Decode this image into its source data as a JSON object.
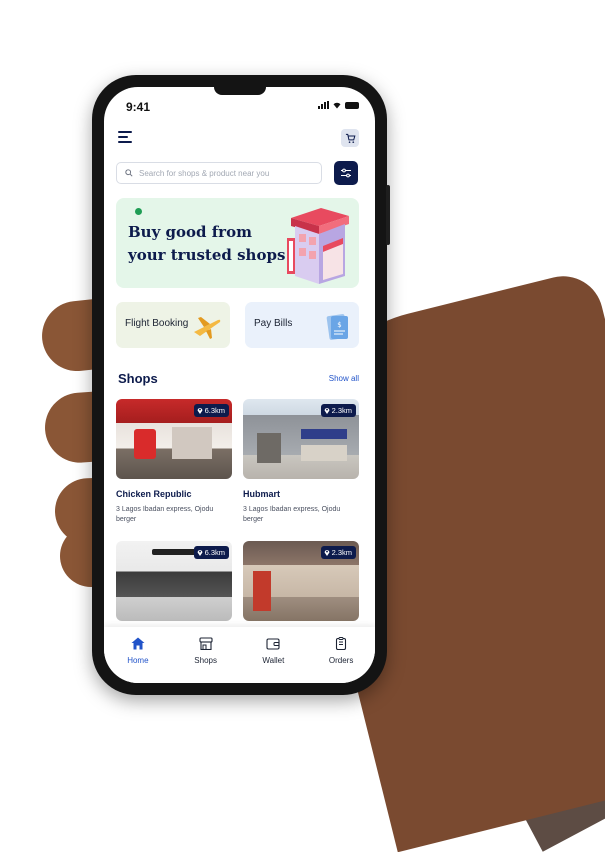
{
  "status_bar": {
    "time": "9:41"
  },
  "header": {
    "menu_icon": "menu-icon",
    "cart_icon": "cart-icon"
  },
  "search": {
    "placeholder": "Search for shops & product near you",
    "search_icon": "search-icon",
    "filter_icon": "filter-icon"
  },
  "banner": {
    "title": "Buy good from your trusted shops",
    "illustration": "shop-building-illustration"
  },
  "quick_actions": [
    {
      "label": "Flight Booking",
      "icon": "airplane-icon",
      "bg": "#eef3e6"
    },
    {
      "label": "Pay Bills",
      "icon": "bill-icon",
      "bg": "#eaf1fb"
    }
  ],
  "shops": {
    "title": "Shops",
    "show_all_label": "Show all",
    "items": [
      {
        "name": "Chicken Republic",
        "address": "3 Lagos Ibadan express, Ojodu berger",
        "distance": "6.3km"
      },
      {
        "name": "Hubmart",
        "address": "3 Lagos Ibadan express, Ojodu berger",
        "distance": "2.3km"
      },
      {
        "name": "",
        "address": "",
        "distance": "6.3km"
      },
      {
        "name": "",
        "address": "",
        "distance": "2.3km"
      }
    ]
  },
  "nav": {
    "items": [
      {
        "label": "Home",
        "icon": "home-icon",
        "active": true
      },
      {
        "label": "Shops",
        "icon": "shops-icon",
        "active": false
      },
      {
        "label": "Wallet",
        "icon": "wallet-icon",
        "active": false
      },
      {
        "label": "Orders",
        "icon": "orders-icon",
        "active": false
      }
    ]
  },
  "colors": {
    "primary": "#0d1b4c",
    "accent": "#2153c9",
    "banner_bg": "#e4f6e9",
    "dot": "#1f9d55"
  }
}
